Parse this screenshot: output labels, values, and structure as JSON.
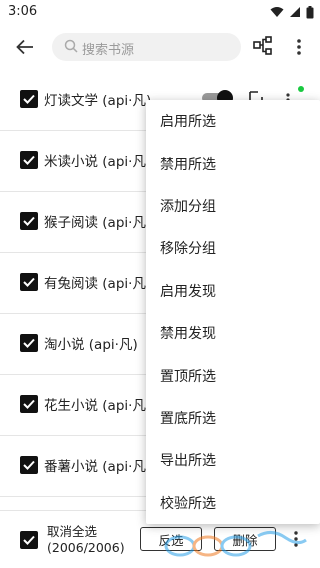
{
  "status": {
    "time": "3:06"
  },
  "search": {
    "placeholder": "搜索书源"
  },
  "sources": [
    {
      "name": "灯读文学 (api·凡)"
    },
    {
      "name": "米读小说 (api·凡)"
    },
    {
      "name": "猴子阅读 (api·凡)"
    },
    {
      "name": "有兔阅读 (api·凡)"
    },
    {
      "name": "淘小说 (api·凡)"
    },
    {
      "name": "花生小说 (api·凡)"
    },
    {
      "name": "番薯小说 (api·凡)"
    }
  ],
  "menu": [
    "启用所选",
    "禁用所选",
    "添加分组",
    "移除分组",
    "启用发现",
    "禁用发现",
    "置顶所选",
    "置底所选",
    "导出所选",
    "校验所选"
  ],
  "bottom": {
    "select_label_line1": "取消全选",
    "select_label_line2": "(2006/2006)",
    "invert_label": "反选",
    "delete_label": "删除"
  },
  "colors": {
    "accent": "#111111",
    "online_dot": "#19c940"
  },
  "icons": [
    "back-arrow-icon",
    "search-icon",
    "group-icon",
    "more-vert-icon",
    "edit-icon",
    "wifi-icon",
    "signal-icon",
    "battery-icon"
  ]
}
